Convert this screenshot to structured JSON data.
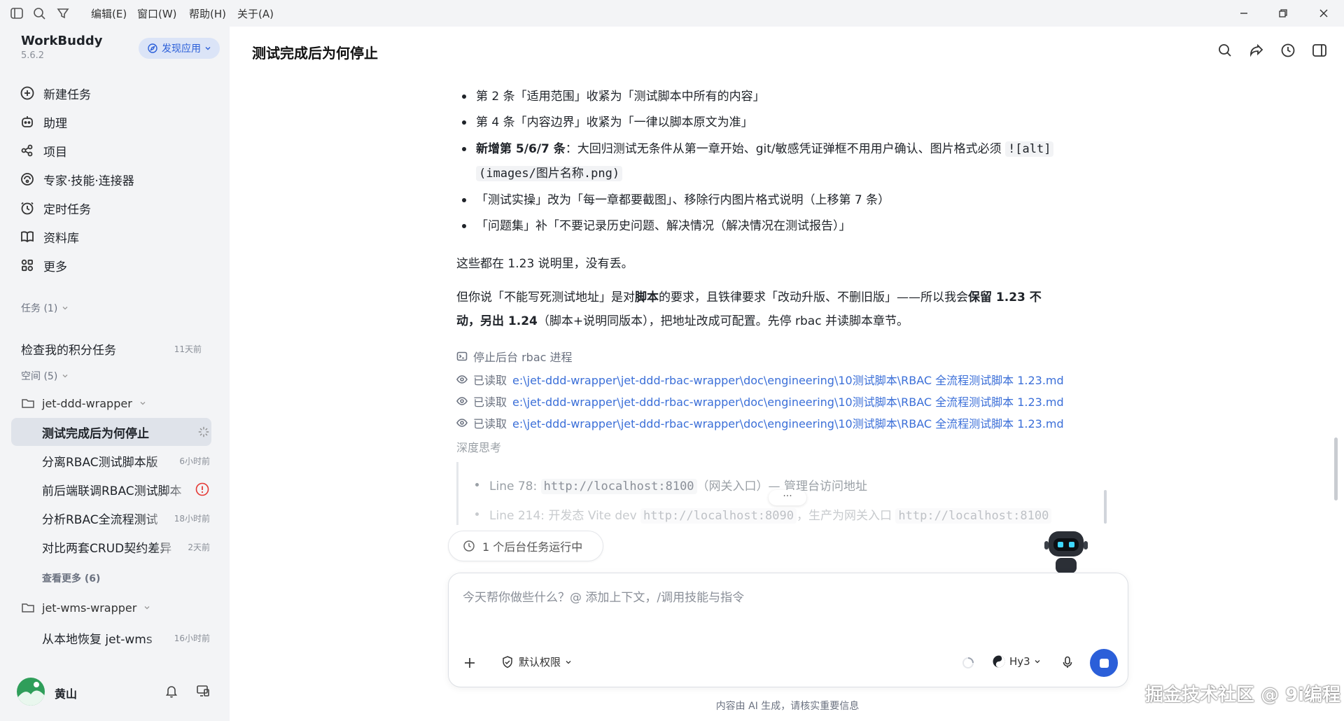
{
  "menu": [
    "编辑(E)",
    "窗口(W)",
    "帮助(H)",
    "关于(A)"
  ],
  "app": {
    "name": "WorkBuddy",
    "version": "5.6.2",
    "discover_label": "发现应用"
  },
  "nav": [
    {
      "label": "新建任务",
      "icon": "plus-circle-icon"
    },
    {
      "label": "助理",
      "icon": "robot-icon"
    },
    {
      "label": "项目",
      "icon": "project-icon"
    },
    {
      "label": "专家·技能·连接器",
      "icon": "expert-icon"
    },
    {
      "label": "定时任务",
      "icon": "clock-icon"
    },
    {
      "label": "资料库",
      "icon": "book-icon"
    },
    {
      "label": "更多",
      "icon": "grid-icon"
    }
  ],
  "tasks_section": {
    "title": "任务 (1)",
    "items": [
      {
        "label": "检查我的积分任务",
        "time": "11天前"
      }
    ]
  },
  "spaces_section": {
    "title": "空间 (5)",
    "folder1": "jet-ddd-wrapper",
    "items": [
      {
        "label": "测试完成后为何停止",
        "time": ""
      },
      {
        "label": "分离RBAC测试脚本版",
        "time": "6小时前"
      },
      {
        "label": "前后端联调RBAC测试脚本",
        "time": ""
      },
      {
        "label": "分析RBAC全流程测试",
        "time": "18小时前"
      },
      {
        "label": "对比两套CRUD契约差异",
        "time": "2天前"
      }
    ],
    "see_more": "查看更多 (6)",
    "folder2": "jet-wms-wrapper",
    "folder2_items": [
      {
        "label": "从本地恢复 jet-wms",
        "time": "16小时前"
      }
    ]
  },
  "user": {
    "name": "黄山"
  },
  "main": {
    "title": "测试完成后为何停止",
    "bullets": [
      "第 2 条「适用范围」收紧为「测试脚本中所有的内容」",
      "第 4 条「内容边界」收紧为「一律以脚本原文为准」"
    ],
    "bullet3_bold": "新增第 5/6/7 条",
    "bullet3_text": "：大回归测试无条件从第一章开始、git/敏感凭证弹框不用用户确认、图片格式必须",
    "bullet3_code1": "![alt]",
    "bullet3_code2": "(images/图片名称.png)",
    "bullet4": "「测试实操」改为「每一章都要截图」、移除行内图片格式说明（上移第 7 条）",
    "bullet5": "「问题集」补「不要记录历史问题、解决情况（解决情况在测试报告）」",
    "para1": "这些都在 1.23 说明里，没有丢。",
    "para2_a": "但你说「不能写死测试地址」是对",
    "para2_b": "脚本",
    "para2_c": "的要求，且铁律要求「改动升版、不删旧版」——所以我会",
    "para2_d": "保留 1.23 不",
    "para2_e": "动，另出 1.24",
    "para2_f": "（脚本+说明同版本），把地址改成可配置。先停 rbac 并读脚本章节。",
    "stop_line": "停止后台 rbac 进程",
    "read_label": "已读取",
    "read_path": "e:\\jet-ddd-wrapper\\jet-ddd-rbac-wrapper\\doc\\engineering\\10测试脚本\\RBAC 全流程测试脚本 1.23.md",
    "thinking_label": "深度思考",
    "think1_a": "Line 78: ",
    "think1_code": "http://localhost:8100",
    "think1_b": "（网关入口）— 管理台访问地址",
    "think2_a": "Line 214: 开发态 Vite dev ",
    "think2_code": "http://localhost:8090",
    "think2_b": "，生产为网关入口 ",
    "think2_code2": "http://localhost:8100"
  },
  "bg_task": "1 个后台任务运行中",
  "composer": {
    "placeholder": "今天帮你做些什么？@ 添加上下文，/调用技能与指令",
    "permission": "默认权限",
    "model": "Hy3"
  },
  "footer": "内容由 AI 生成，请核实重要信息",
  "watermark": "掘金技术社区 @ 9i编程",
  "colors": {
    "accent": "#2b5fd9",
    "sidebar_bg": "#f3f4f6",
    "link": "#3b6fd8"
  }
}
